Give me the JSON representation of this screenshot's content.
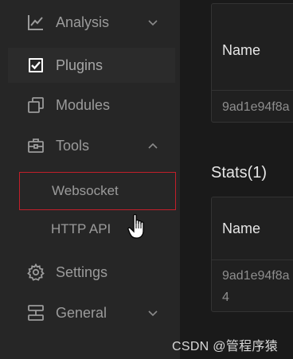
{
  "sidebar": {
    "items": [
      {
        "label": "Analysis",
        "icon": "chart-line-icon",
        "expand": "chevron-down-icon"
      },
      {
        "label": "Plugins",
        "icon": "checkbox-icon"
      },
      {
        "label": "Modules",
        "icon": "copy-icon"
      },
      {
        "label": "Tools",
        "icon": "toolbox-icon",
        "expand": "chevron-up-icon"
      },
      {
        "label": "Settings",
        "icon": "gear-icon"
      },
      {
        "label": "General",
        "icon": "server-icon",
        "expand": "chevron-down-icon"
      }
    ],
    "tools_subitems": [
      {
        "label": "Websocket",
        "selected": true
      },
      {
        "label": "HTTP API",
        "selected": false
      }
    ]
  },
  "main": {
    "card1": {
      "header": "Name",
      "row": "9ad1e94f8a"
    },
    "stats_title": "Stats(1)",
    "card2": {
      "header": "Name",
      "row_line1": "9ad1e94f8a",
      "row_line2": "4"
    }
  },
  "watermark": "CSDN @管程序猿",
  "colors": {
    "sidebar_bg": "#262626",
    "main_bg": "#1a1a1a",
    "selection_border": "#c21f2a",
    "text_muted": "#9b9b9b",
    "text_bright": "#e6e6e6"
  }
}
